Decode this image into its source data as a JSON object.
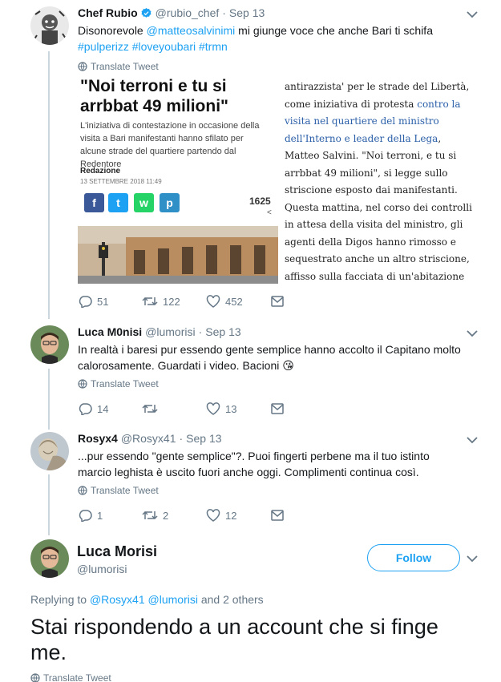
{
  "tweet1": {
    "name": "Chef Rubio",
    "handle": "@rubio_chef",
    "dot": "·",
    "date": "Sep 13",
    "text_lead": "Disonorevole ",
    "mention": "@matteosalvinimi",
    "text_mid": " mi giunge voce che anche Bari ti schifa",
    "hashtags": "#pulperizz #loveyoubari #trmn",
    "translate": "Translate Tweet",
    "card": {
      "headline": "\"Noi terroni e tu si arrbbat 49 milioni\"",
      "subtitle": "L'iniziativa di contestazione in occasione della visita a Bari manifestanti hanno sfilato per alcune strade del quartiere partendo dal Redentore",
      "author": "Redazione",
      "date": "13 SETTEMBRE 2018 11:49",
      "share_count": "1625",
      "share_icons": [
        "f",
        "t",
        "w",
        "p"
      ],
      "article_a": "antirazzista' per le strade del Libertà, come iniziativa di protesta ",
      "article_link": "contro la visita nel quartiere del ministro dell'Interno e leader della Lega",
      "article_b": ", Matteo Salvini. \"Noi terroni, e tu si arrbbat 49 milioni\", si legge sullo striscione esposto dai manifestanti. Questa mattina, nel corso dei controlli in attesa della visita del ministro, gli agenti della Digos hanno rimosso e sequestrato anche un altro striscione, affisso sulla facciata di un'abitazione al quartiere Libertà, con la scritta \"Salvini bimbominkia\""
    },
    "replies": "51",
    "retweets": "122",
    "likes": "452"
  },
  "tweet2": {
    "name": "Luca M0nisi",
    "handle": "@lumorisi",
    "dot": "·",
    "date": "Sep 13",
    "text": "In realtà i baresi pur essendo gente semplice hanno accolto il Capitano molto calorosamente. Guardati i video. Bacioni",
    "emoji": "😘",
    "translate": "Translate Tweet",
    "replies": "14",
    "retweets": "",
    "likes": "13"
  },
  "tweet3": {
    "name": "Rosyx4",
    "handle": "@Rosyx41",
    "dot": "·",
    "date": "Sep 13",
    "text": "...pur essendo \"gente semplice\"?. Puoi fingerti perbene ma il tuo istinto marcio leghista è uscito fuori anche oggi. Complimenti continua così.",
    "translate": "Translate Tweet",
    "replies": "1",
    "retweets": "2",
    "likes": "12"
  },
  "focused": {
    "name": "Luca Morisi",
    "handle": "@lumorisi",
    "follow_label": "Follow",
    "replying_prefix": "Replying to ",
    "replying_users": "@Rosyx41 @lumorisi",
    "replying_suffix": " and 2 others",
    "text": "Stai rispondendo a un account che si finge me.",
    "translate": "Translate Tweet"
  },
  "colors": {
    "accent": "#1da1f2",
    "muted": "#657786",
    "like": "#e0245e",
    "facebook": "#3b5998",
    "twitter": "#1da1f2",
    "whatsapp": "#25d366",
    "telegram": "#2f8fc7"
  }
}
